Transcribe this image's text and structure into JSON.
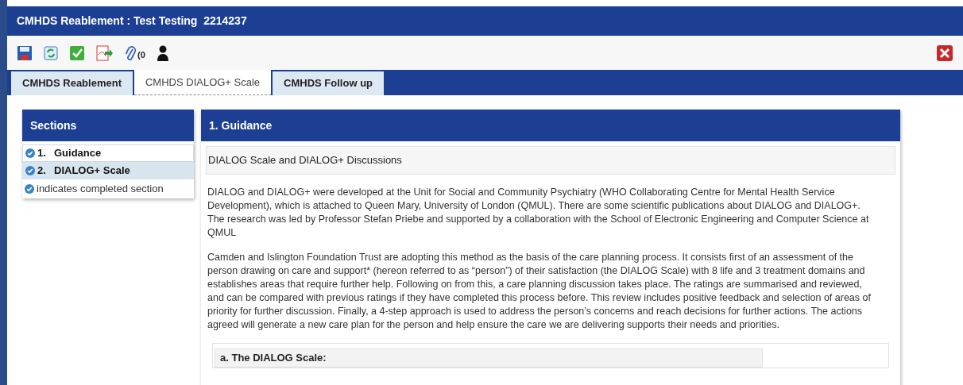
{
  "window": {
    "title": "CMHDS Reablement : Test Testing  2214237"
  },
  "toolbar": {
    "attachment_count": "(0"
  },
  "tabs": [
    {
      "label": "CMHDS Reablement",
      "selected": false
    },
    {
      "label": "CMHDS DIALOG+ Scale",
      "selected": true
    },
    {
      "label": "CMHDS Follow up",
      "selected": false
    }
  ],
  "sidebar": {
    "title": "Sections",
    "items": [
      {
        "number": "1.",
        "label": "Guidance",
        "completed": true,
        "selected": true
      },
      {
        "number": "2.",
        "label": "DIALOG+ Scale",
        "completed": true,
        "selected": false
      }
    ],
    "legend": "indicates completed section"
  },
  "section": {
    "title": "1. Guidance",
    "subheading": "DIALOG Scale and DIALOG+ Discussions",
    "paragraphs": [
      "DIALOG and DIALOG+ were developed at the Unit for Social and Community Psychiatry (WHO Collaborating Centre for Mental Health Service Development), which is attached to Queen Mary, University of London (QMUL). There are some scientific publications about DIALOG and DIALOG+. The research was led by Professor Stefan Priebe and supported by a collaboration with the School of Electronic Engineering and Computer Science at QMUL",
      "Camden and Islington Foundation Trust are adopting this method as the basis of the care planning process. It consists first of an assessment of the person drawing on care and support* (hereon referred to as “person”) of their satisfaction (the DIALOG Scale) with 8 life and 3 treatment domains and establishes areas that require further help. Following on from this, a care planning discussion takes place. The ratings are summarised and reviewed, and can be compared with previous ratings if they have completed this process before. This review includes positive feedback and selection of areas of priority for further discussion. Finally, a 4-step approach is used to address the person’s concerns and reach decisions for further actions. The actions agreed will generate a new care plan for the person and help ensure the care we are delivering supports their needs and priorities."
    ],
    "subsection": {
      "title": "a. The DIALOG Scale:"
    }
  }
}
